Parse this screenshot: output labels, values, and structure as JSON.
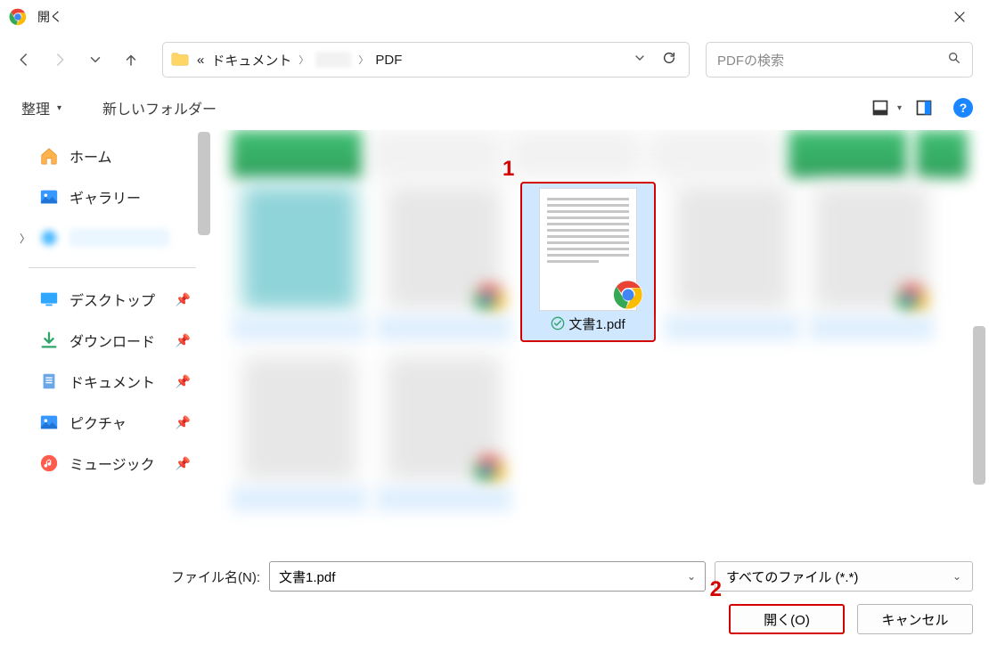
{
  "title": "開く",
  "breadcrumb": {
    "double_chevron": "«",
    "seg1": "ドキュメント",
    "seg2": "PDF"
  },
  "search": {
    "placeholder": "PDFの検索"
  },
  "toolbar": {
    "organize": "整理",
    "new_folder": "新しいフォルダー"
  },
  "sidebar": {
    "home": "ホーム",
    "gallery": "ギャラリー",
    "desktop": "デスクトップ",
    "downloads": "ダウンロード",
    "documents": "ドキュメント",
    "pictures": "ピクチャ",
    "music": "ミュージック"
  },
  "selected_file": {
    "name": "文書1.pdf"
  },
  "filename_row": {
    "label": "ファイル名(N):",
    "value": "文書1.pdf"
  },
  "filetype": {
    "label": "すべてのファイル (*.*)"
  },
  "buttons": {
    "open": "開く(O)",
    "cancel": "キャンセル"
  },
  "annotations": {
    "one": "1",
    "two": "2"
  }
}
